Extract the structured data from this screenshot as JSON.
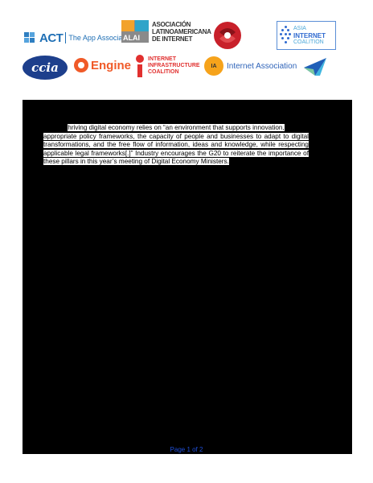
{
  "logos": {
    "act": {
      "word": "ACT",
      "sub": "The App Association"
    },
    "alai": {
      "box": "ALAI",
      "lines": [
        "ASOCIACIÓN",
        "LATINOAMERICANA",
        "DE INTERNET"
      ]
    },
    "aic": {
      "lines": [
        "ASIA",
        "INTERNET",
        "COALITION"
      ]
    },
    "ccia": {
      "word": "ccia"
    },
    "engine": {
      "word": "Engine"
    },
    "iic": {
      "lines": [
        "INTERNET",
        "INFRASTRUCTURE",
        "COALITION"
      ]
    },
    "ia": {
      "mark": "IA",
      "label": "Internet Association"
    }
  },
  "body": {
    "line1": "hriving digital economy relies on “an environment that supports innovation,",
    "rest": "appropriate policy frameworks, the capacity of people and businesses to adapt to digital transformations, and the free flow of information, ideas and knowledge, while respecting applicable legal frameworks[.]” Industry encourages the G20 to reiterate the importance of these pillars in this year’s meeting of Digital Economy Ministers."
  },
  "footer": {
    "page_label": "Page 1 of 2"
  },
  "colors": {
    "page_bg": "#000000",
    "footer_text": "#1f4fd8"
  }
}
